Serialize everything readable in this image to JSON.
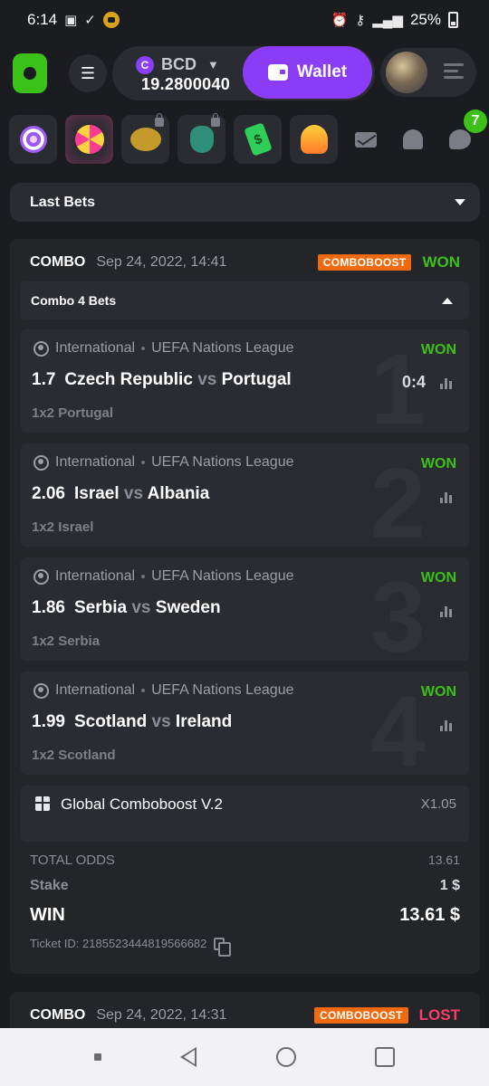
{
  "status_bar": {
    "time": "6:14",
    "battery": "25%"
  },
  "header": {
    "currency": "BCD",
    "currency_symbol": "C",
    "balance": "19.2800040",
    "wallet_label": "Wallet"
  },
  "promos": {
    "chat_badge": "7"
  },
  "last_bets": {
    "label": "Last Bets"
  },
  "bet": {
    "type": "COMBO",
    "date": "Sep 24, 2022, 14:41",
    "boost_badge": "COMBOBOOST",
    "status": "WON",
    "subheader": "Combo 4 Bets",
    "legs": [
      {
        "region": "International",
        "league": "UEFA Nations League",
        "status": "WON",
        "odds": "1.7",
        "home": "Czech Republic",
        "vs": "vs",
        "away": "Portugal",
        "score": "0:4",
        "pick": "1x2 Portugal",
        "number": "1"
      },
      {
        "region": "International",
        "league": "UEFA Nations League",
        "status": "WON",
        "odds": "2.06",
        "home": "Israel",
        "vs": "vs",
        "away": "Albania",
        "score": "",
        "pick": "1x2 Israel",
        "number": "2"
      },
      {
        "region": "International",
        "league": "UEFA Nations League",
        "status": "WON",
        "odds": "1.86",
        "home": "Serbia",
        "vs": "vs",
        "away": "Sweden",
        "score": "",
        "pick": "1x2 Serbia",
        "number": "3"
      },
      {
        "region": "International",
        "league": "UEFA Nations League",
        "status": "WON",
        "odds": "1.99",
        "home": "Scotland",
        "vs": "vs",
        "away": "Ireland",
        "score": "",
        "pick": "1x2 Scotland",
        "number": "4"
      }
    ],
    "comboboost": {
      "name": "Global Comboboost V.2",
      "multiplier": "X1.05"
    },
    "total_odds_label": "TOTAL ODDS",
    "total_odds": "13.61",
    "stake_label": "Stake",
    "stake": "1 $",
    "win_label": "WIN",
    "win": "13.61 $",
    "ticket": "Ticket ID: 2185523444819566682"
  },
  "next_bet": {
    "type": "COMBO",
    "date": "Sep 24, 2022, 14:31",
    "boost_badge": "COMBOBOOST",
    "status": "LOST"
  },
  "colors": {
    "accent_green": "#3bc117",
    "wallet_purple": "#8b3cf7",
    "boost_orange": "#f06a0d",
    "lost_red": "#ff3b6b"
  }
}
